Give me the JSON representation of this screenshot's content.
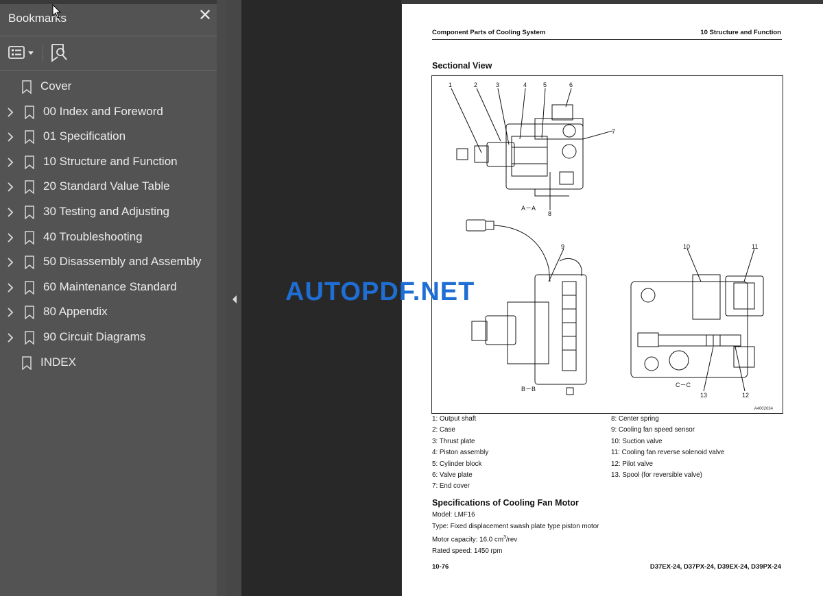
{
  "sidebar": {
    "title": "Bookmarks",
    "close_glyph": "✕",
    "toolbar": {
      "options_icon": "bookmark-options-icon",
      "find_icon": "find-bookmark-icon"
    },
    "items": [
      {
        "label": "Cover",
        "expandable": false
      },
      {
        "label": "00 Index and Foreword",
        "expandable": true
      },
      {
        "label": "01 Specification",
        "expandable": true
      },
      {
        "label": "10 Structure and Function",
        "expandable": true
      },
      {
        "label": "20 Standard Value Table",
        "expandable": true
      },
      {
        "label": "30 Testing and Adjusting",
        "expandable": true
      },
      {
        "label": "40 Troubleshooting",
        "expandable": true
      },
      {
        "label": "50 Disassembly and Assembly",
        "expandable": true
      },
      {
        "label": "60 Maintenance Standard",
        "expandable": true
      },
      {
        "label": "80 Appendix",
        "expandable": true
      },
      {
        "label": "90 Circuit Diagrams",
        "expandable": true
      },
      {
        "label": "INDEX",
        "expandable": false
      }
    ]
  },
  "page": {
    "header_left": "Component Parts of Cooling System",
    "header_right": "10 Structure and Function",
    "section_title": "Sectional View",
    "figure": {
      "code": "A4002034",
      "callouts_top": [
        "1",
        "2",
        "3",
        "4",
        "5",
        "6",
        "7",
        "8"
      ],
      "view_aa": "A－A",
      "view_bb": "B－B",
      "view_cc": "C－C",
      "callouts_bb": [
        "9"
      ],
      "callouts_cc": [
        "10",
        "11",
        "12",
        "13"
      ]
    },
    "legend_left": [
      "1: Output shaft",
      "2: Case",
      "3: Thrust plate",
      "4: Piston assembly",
      "5: Cylinder block",
      "6: Valve plate",
      "7: End cover"
    ],
    "legend_right": [
      "8: Center spring",
      "9: Cooling fan speed sensor",
      "10: Suction valve",
      "11: Cooling fan reverse solenoid valve",
      "12: Pilot valve",
      "13. Spool (for reversible valve)"
    ],
    "spec_title": "Specifications of Cooling Fan Motor",
    "spec_model": "Model: LMF16",
    "spec_type": "Type: Fixed displacement swash plate type piston motor",
    "spec_capacity_prefix": "Motor capacity: 16.0 cm",
    "spec_capacity_sup": "3",
    "spec_capacity_suffix": "/rev",
    "spec_speed": "Rated speed: 1450 rpm",
    "footer_left": "10-76",
    "footer_right": "D37EX-24, D37PX-24, D39EX-24, D39PX-24"
  },
  "watermark": "AUTOPDF.NET"
}
